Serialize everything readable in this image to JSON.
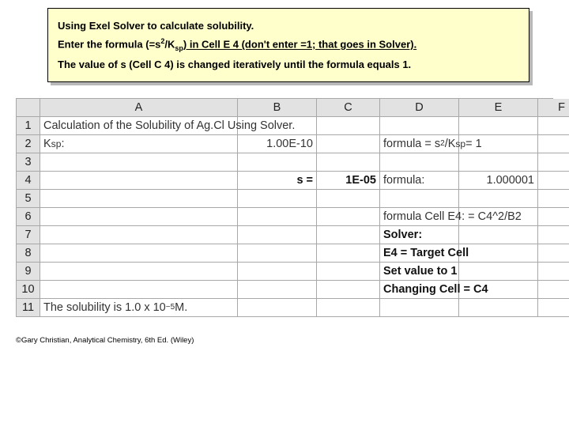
{
  "note": {
    "line1": "Using Exel Solver to calculate solubility.",
    "line2_pre": "Enter the formula (=s",
    "line2_sup": "2",
    "line2_mid": "/K",
    "line2_sub": "sp",
    "line2_post": ") in Cell E 4 (don't enter =1; that goes in Solver).",
    "line3": "The value of s (Cell C 4) is changed iteratively until the formula equals 1."
  },
  "headers": {
    "A": "A",
    "B": "B",
    "C": "C",
    "D": "D",
    "E": "E",
    "F": "F"
  },
  "rows": {
    "r1_A": "Calculation of the Solubility of Ag.Cl Using Solver.",
    "r2_A_pre": "K",
    "r2_A_sub": "sp",
    "r2_A_post": ":",
    "r2_B": "1.00E-10",
    "r2_D_pre": "formula = s",
    "r2_D_sup": "2",
    "r2_D_mid": "/K",
    "r2_D_sub": "sp",
    "r2_D_post": " = 1",
    "r4_B": "s =",
    "r4_C": "1E-05",
    "r4_D": "formula:",
    "r4_E": "1.000001",
    "r6_D": "formula Cell E4: = C4^2/B2",
    "r7_D": "Solver:",
    "r8_D": "E4 = Target Cell",
    "r9_D": "Set value to 1",
    "r10_D": "Changing Cell = C4",
    "r11_A_pre": "The solubility is 1.0 x 10",
    "r11_A_sup": "−5",
    "r11_A_post": " M."
  },
  "rownums": {
    "1": "1",
    "2": "2",
    "3": "3",
    "4": "4",
    "5": "5",
    "6": "6",
    "7": "7",
    "8": "8",
    "9": "9",
    "10": "10",
    "11": "11"
  },
  "credit": "©Gary Christian, Analytical Chemistry,   6th Ed. (Wiley)"
}
